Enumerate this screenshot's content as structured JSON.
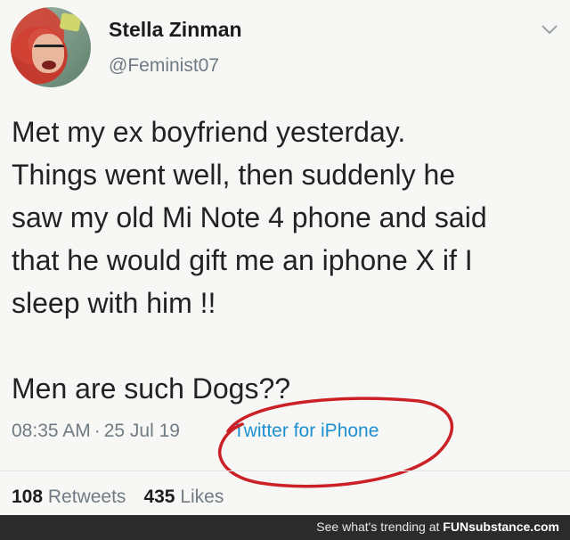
{
  "tweet": {
    "author": {
      "display_name": "Stella Zinman",
      "handle": "@Feminist07"
    },
    "body_lines": [
      "Met my ex boyfriend yesterday.",
      "Things went well, then suddenly he",
      "saw my old Mi Note 4 phone and said",
      "that he would gift me an iphone X if I",
      "sleep with him !!"
    ],
    "closing_line": "Men are such Dogs??",
    "time": "08:35 AM",
    "date": "25 Jul 19",
    "meta_separator": "·",
    "source": "Twitter for iPhone",
    "stats": {
      "retweets_count": "108",
      "retweets_label": "Retweets",
      "likes_count": "435",
      "likes_label": "Likes"
    }
  },
  "annotation": {
    "color": "#cc2027"
  },
  "footer": {
    "prefix": "See what's trending at",
    "brand_bold": "FUN",
    "brand_rest": "substance.com"
  },
  "colors": {
    "background": "#f7f7f5",
    "link": "#1e8fcf",
    "muted": "#707b84",
    "footer_bar": "#2b2b2b"
  }
}
